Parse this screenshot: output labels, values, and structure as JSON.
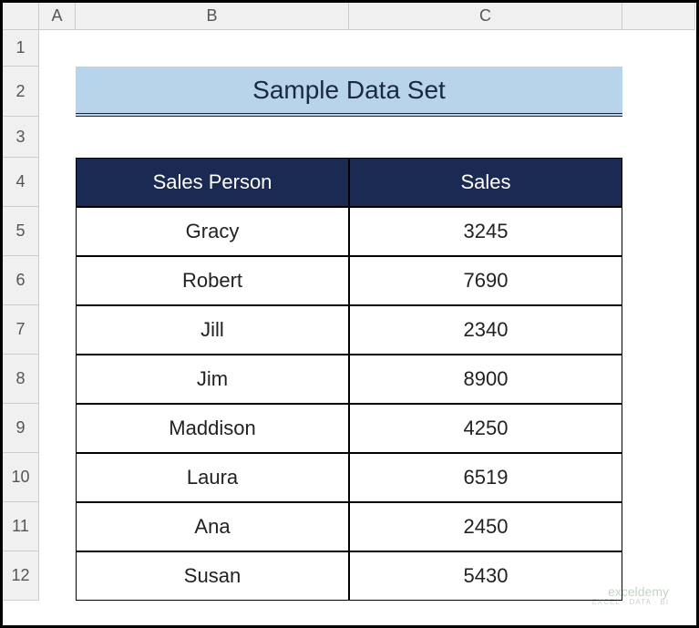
{
  "columns": [
    "",
    "A",
    "B",
    "C",
    ""
  ],
  "rows": [
    "1",
    "2",
    "3",
    "4",
    "5",
    "6",
    "7",
    "8",
    "9",
    "10",
    "11",
    "12"
  ],
  "title": "Sample Data Set",
  "headers": {
    "person": "Sales Person",
    "sales": "Sales"
  },
  "data": [
    {
      "person": "Gracy",
      "sales": "3245"
    },
    {
      "person": "Robert",
      "sales": "7690"
    },
    {
      "person": "Jill",
      "sales": "2340"
    },
    {
      "person": "Jim",
      "sales": "8900"
    },
    {
      "person": "Maddison",
      "sales": "4250"
    },
    {
      "person": "Laura",
      "sales": "6519"
    },
    {
      "person": "Ana",
      "sales": "2450"
    },
    {
      "person": "Susan",
      "sales": "5430"
    }
  ],
  "watermark": {
    "main": "exceldemy",
    "sub": "EXCEL · DATA · BI"
  }
}
